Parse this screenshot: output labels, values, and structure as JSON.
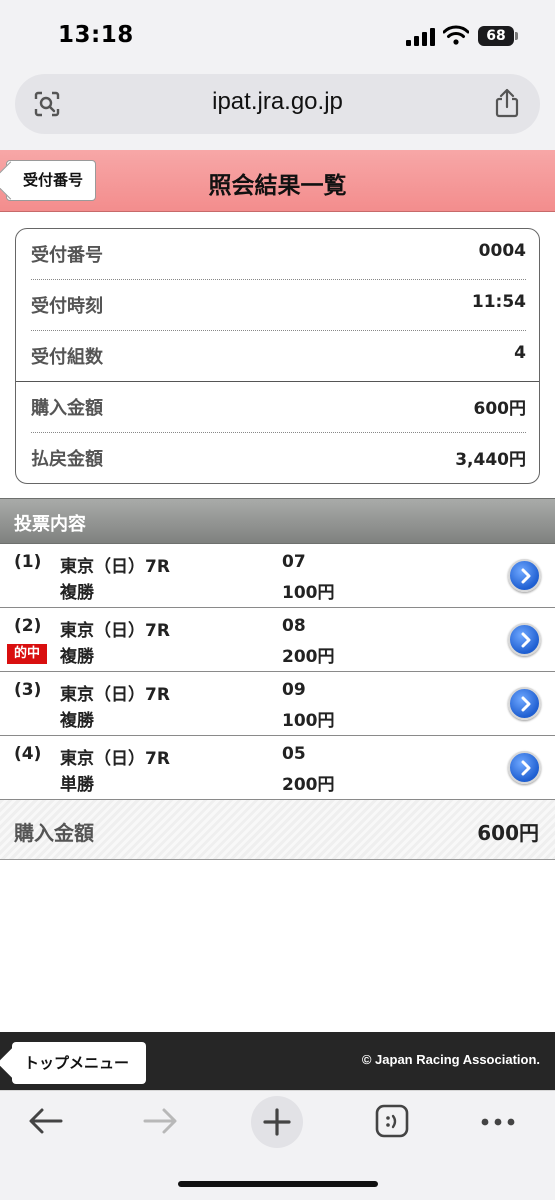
{
  "status_bar": {
    "time": "13:18",
    "battery": "68"
  },
  "url_bar": {
    "url": "ipat.jra.go.jp"
  },
  "header": {
    "back_label": "受付番号",
    "title": "照会結果一覧"
  },
  "summary": [
    {
      "label": "受付番号",
      "value": "0004"
    },
    {
      "label": "受付時刻",
      "value": "11:54"
    },
    {
      "label": "受付組数",
      "value": "4"
    },
    {
      "label": "購入金額",
      "value": "600円"
    },
    {
      "label": "払戻金額",
      "value": "3,440円"
    }
  ],
  "section_title": "投票内容",
  "bets": [
    {
      "num": "(1)",
      "race": "東京（日）7R",
      "type": "複勝",
      "horse": "07",
      "amount": "100円",
      "hit": ""
    },
    {
      "num": "(2)",
      "race": "東京（日）7R",
      "type": "複勝",
      "horse": "08",
      "amount": "200円",
      "hit": "的中"
    },
    {
      "num": "(3)",
      "race": "東京（日）7R",
      "type": "複勝",
      "horse": "09",
      "amount": "100円",
      "hit": ""
    },
    {
      "num": "(4)",
      "race": "東京（日）7R",
      "type": "単勝",
      "horse": "05",
      "amount": "200円",
      "hit": ""
    }
  ],
  "total": {
    "label": "購入金額",
    "value": "600円"
  },
  "footer": {
    "top_menu_label": "トップメニュー",
    "copyright": "© Japan Racing Association."
  },
  "icons": {
    "back": "back-arrow-icon",
    "forward": "forward-arrow-icon",
    "new_tab": "plus-icon",
    "tabs": "tabs-icon",
    "more": "more-icon",
    "detail": "chevron-right-icon"
  },
  "colors": {
    "header_pink": "#f38d8d",
    "section_gray": "#8f918f",
    "hit_red": "#d90f0f",
    "detail_blue": "#1f5fd1",
    "footer_dark": "#262626"
  }
}
